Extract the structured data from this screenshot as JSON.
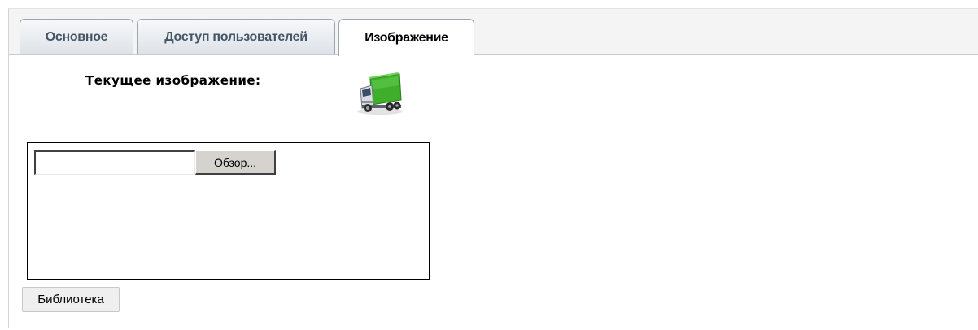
{
  "tabs": [
    {
      "label": "Основное",
      "active": false
    },
    {
      "label": "Доступ пользователей",
      "active": false
    },
    {
      "label": "Изображение",
      "active": true
    }
  ],
  "image_section": {
    "label": "Текущее изображение:",
    "icon": "truck-icon"
  },
  "upload": {
    "file_value": "",
    "browse_label": "Обзор..."
  },
  "library_label": "Библиотека",
  "colors": {
    "tab_border": "#9aa6b2",
    "tab_text_inactive": "#445566",
    "truck_cargo": "#3fae2a",
    "button_face": "#d6d3ce"
  }
}
